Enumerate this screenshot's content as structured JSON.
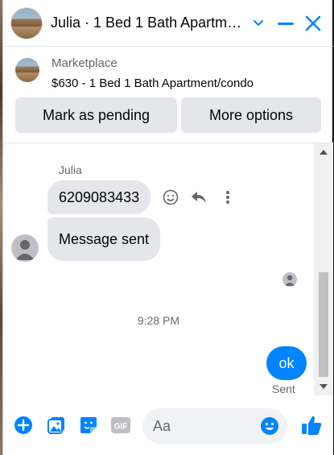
{
  "header": {
    "title": "Julia · 1 Bed 1 Bath Apartment/condo"
  },
  "marketplace": {
    "label": "Marketplace",
    "item": "$630 - 1 Bed 1 Bath Apartment/condo",
    "buttons": [
      "Mark as pending",
      "More options"
    ]
  },
  "chat": {
    "sender": "Julia",
    "messages": [
      {
        "from": "Julia",
        "text": "6209083433"
      },
      {
        "from": "Julia",
        "text": "Message sent"
      }
    ],
    "timestamp": "9:28 PM",
    "my_message": "ok",
    "my_status": "Sent"
  },
  "composer": {
    "placeholder": "Aa"
  },
  "colors": {
    "accent": "#0084ff",
    "bubble": "#e4e6eb",
    "muted": "#65676b"
  },
  "icons": [
    "chevron-down-icon",
    "minimize-icon",
    "close-icon",
    "emoji-icon",
    "reply-icon",
    "more-icon",
    "plus-icon",
    "image-icon",
    "sticker-icon",
    "gif-icon",
    "like-icon"
  ]
}
